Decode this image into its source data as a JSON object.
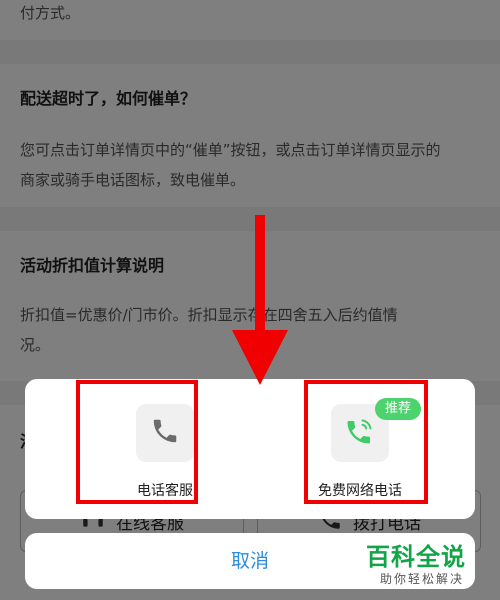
{
  "faq": {
    "partial_text": "付方式。",
    "item1": {
      "title": "配送超时了，如何催单？",
      "answer_line1": "您可点击订单详情页中的“催单”按钮，或点击订单详情页显示的",
      "answer_line2": "商家或骑手电话图标，致电催单。"
    },
    "item2": {
      "title": "活动折扣值计算说明",
      "answer_line1": "折扣值=优惠价/门市价。折扣显示存在四舍五入后约值情",
      "answer_line2": "况。"
    },
    "item3_partial_title": "活"
  },
  "bottom_buttons": {
    "online_service": "在线客服",
    "call": "拨打电话"
  },
  "action_sheet": {
    "options": [
      {
        "label": "电话客服",
        "icon": "phone-icon"
      },
      {
        "label": "免费网络电话",
        "icon": "wifi-phone-icon",
        "badge": "推荐"
      }
    ],
    "cancel_label": "取消"
  },
  "annotations": {
    "highlight_color": "#f00000",
    "arrow": "down-arrow"
  },
  "watermark": {
    "main": "百科全说",
    "sub": "助你轻松解决"
  },
  "colors": {
    "accent_blue": "#2d8de0",
    "badge_green": "#4cd36e",
    "phone_gray": "#6b6b6b",
    "phone_green": "#3ecb68",
    "watermark_green": "#12a548"
  }
}
